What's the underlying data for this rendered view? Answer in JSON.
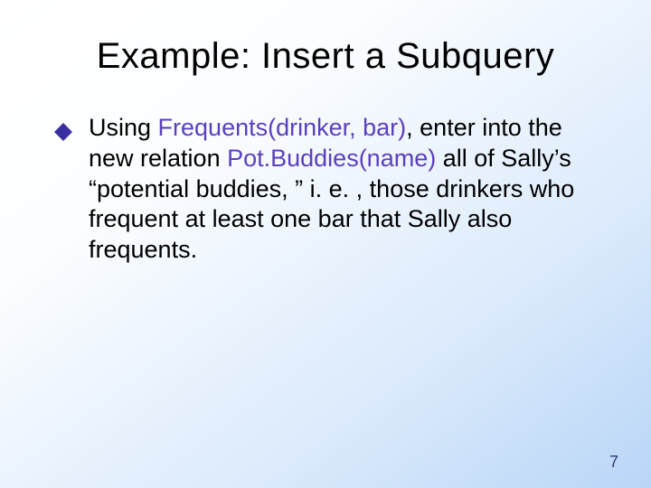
{
  "title": "Example: Insert a Subquery",
  "body": {
    "pre1": "Using ",
    "schema1": "Frequents(drinker, bar)",
    "mid1": ", enter into the new relation ",
    "schema2": "Pot.Buddies(name)",
    "post1": " all of Sally’s “potential buddies, ” i. e. , those drinkers who frequent at least one bar that Sally also frequents."
  },
  "page_number": "7"
}
